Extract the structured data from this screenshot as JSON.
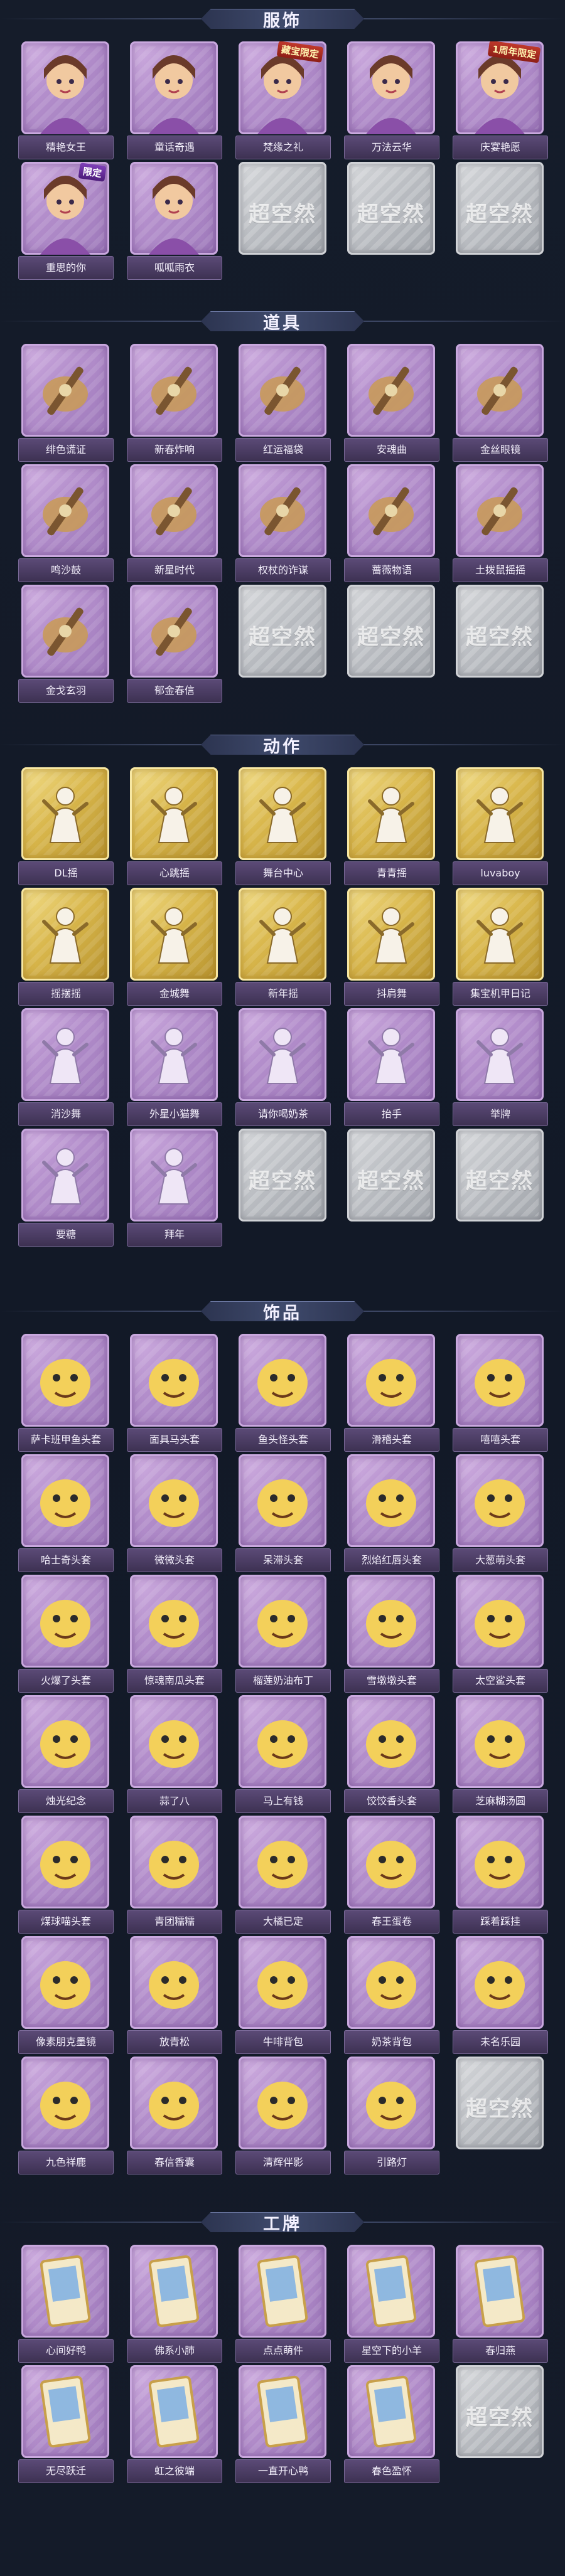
{
  "sections": [
    {
      "title": "服饰",
      "items": [
        {
          "name": "精艳女王",
          "kind": "costume",
          "icon": "queen-costume-icon",
          "tag": ""
        },
        {
          "name": "童话奇遇",
          "kind": "costume",
          "icon": "fairy-girl-costume-icon",
          "tag": ""
        },
        {
          "name": "梵缘之礼",
          "kind": "costume",
          "icon": "white-hair-costume-icon",
          "tag": "藏宝限定"
        },
        {
          "name": "万法云华",
          "kind": "costume",
          "icon": "blue-hair-costume-icon",
          "tag": ""
        },
        {
          "name": "庆宴艳愿",
          "kind": "costume",
          "icon": "party-costume-icon",
          "tag": "1周年限定"
        },
        {
          "name": "重思的你",
          "kind": "costume",
          "icon": "blue-hat-costume-icon",
          "tag": "限定"
        },
        {
          "name": "呱呱雨衣",
          "kind": "costume",
          "icon": "frog-raincoat-costume-icon",
          "tag": ""
        },
        {
          "name": "",
          "kind": "empty",
          "icon": "",
          "tag": ""
        },
        {
          "name": "",
          "kind": "empty",
          "icon": "",
          "tag": ""
        },
        {
          "name": "",
          "kind": "empty",
          "icon": "",
          "tag": ""
        }
      ]
    },
    {
      "title": "道具",
      "items": [
        {
          "name": "绯色谎证",
          "kind": "prop",
          "icon": "sword-icon",
          "tag": ""
        },
        {
          "name": "新春炸响",
          "kind": "prop",
          "icon": "firecracker-icon",
          "tag": ""
        },
        {
          "name": "红运福袋",
          "kind": "prop",
          "icon": "lucky-bag-icon",
          "tag": ""
        },
        {
          "name": "安魂曲",
          "kind": "prop",
          "icon": "red-sword-icon",
          "tag": ""
        },
        {
          "name": "金丝眼镜",
          "kind": "prop",
          "icon": "glasses-icon",
          "tag": ""
        },
        {
          "name": "鸣沙鼓",
          "kind": "prop",
          "icon": "staff-icon",
          "tag": ""
        },
        {
          "name": "新星时代",
          "kind": "prop",
          "icon": "revolver-icon",
          "tag": ""
        },
        {
          "name": "权杖的诈谋",
          "kind": "prop",
          "icon": "scepter-icon",
          "tag": ""
        },
        {
          "name": "蔷薇物语",
          "kind": "prop",
          "icon": "medkit-icon",
          "tag": ""
        },
        {
          "name": "土拨鼠摇摇",
          "kind": "prop",
          "icon": "groundhog-icon",
          "tag": ""
        },
        {
          "name": "金戈玄羽",
          "kind": "prop",
          "icon": "lantern-icon",
          "tag": ""
        },
        {
          "name": "郁金春信",
          "kind": "prop",
          "icon": "fan-icon",
          "tag": ""
        },
        {
          "name": "",
          "kind": "empty",
          "icon": "",
          "tag": ""
        },
        {
          "name": "",
          "kind": "empty",
          "icon": "",
          "tag": ""
        },
        {
          "name": "",
          "kind": "empty",
          "icon": "",
          "tag": ""
        }
      ]
    },
    {
      "title": "动作",
      "items": [
        {
          "name": "DL摇",
          "kind": "action-gold",
          "icon": "dance-pose-icon",
          "tag": ""
        },
        {
          "name": "心跳摇",
          "kind": "action-gold",
          "icon": "dance-pose-icon",
          "tag": ""
        },
        {
          "name": "舞台中心",
          "kind": "action-gold",
          "icon": "dance-pose-icon",
          "tag": ""
        },
        {
          "name": "青青摇",
          "kind": "action-gold",
          "icon": "dance-pose-icon",
          "tag": ""
        },
        {
          "name": "luvaboy",
          "kind": "action-gold",
          "icon": "dance-pose-icon",
          "tag": ""
        },
        {
          "name": "摇摆摇",
          "kind": "action-gold",
          "icon": "dance-pose-icon",
          "tag": ""
        },
        {
          "name": "金城舞",
          "kind": "action-gold",
          "icon": "dance-pose-icon",
          "tag": ""
        },
        {
          "name": "新年摇",
          "kind": "action-gold",
          "icon": "dance-pose-icon",
          "tag": ""
        },
        {
          "name": "抖肩舞",
          "kind": "action-gold",
          "icon": "dance-pose-icon",
          "tag": ""
        },
        {
          "name": "集宝机甲日记",
          "kind": "action-gold",
          "icon": "dance-pose-icon",
          "tag": ""
        },
        {
          "name": "消沙舞",
          "kind": "action",
          "icon": "pose-icon",
          "tag": ""
        },
        {
          "name": "外星小猫舞",
          "kind": "action",
          "icon": "pose-icon",
          "tag": ""
        },
        {
          "name": "请你喝奶茶",
          "kind": "action",
          "icon": "pose-icon",
          "tag": ""
        },
        {
          "name": "抬手",
          "kind": "action",
          "icon": "pose-icon",
          "tag": ""
        },
        {
          "name": "举牌",
          "kind": "action",
          "icon": "pose-icon",
          "tag": ""
        },
        {
          "name": "要糖",
          "kind": "action",
          "icon": "pose-icon",
          "tag": ""
        },
        {
          "name": "拜年",
          "kind": "action",
          "icon": "pose-icon",
          "tag": ""
        },
        {
          "name": "",
          "kind": "empty",
          "icon": "",
          "tag": ""
        },
        {
          "name": "",
          "kind": "empty",
          "icon": "",
          "tag": ""
        },
        {
          "name": "",
          "kind": "empty",
          "icon": "",
          "tag": ""
        }
      ]
    },
    {
      "title": "饰品",
      "items": [
        {
          "name": "萨卡班甲鱼头套",
          "kind": "accessory",
          "icon": "fish-head-icon",
          "tag": ""
        },
        {
          "name": "面具马头套",
          "kind": "accessory",
          "icon": "horse-head-icon",
          "tag": ""
        },
        {
          "name": "鱼头怪头套",
          "kind": "accessory",
          "icon": "fish-monster-head-icon",
          "tag": ""
        },
        {
          "name": "滑稽头套",
          "kind": "accessory",
          "icon": "smirk-emoji-head-icon",
          "tag": ""
        },
        {
          "name": "嘻嘻头套",
          "kind": "accessory",
          "icon": "grin-emoji-head-icon",
          "tag": ""
        },
        {
          "name": "哈士奇头套",
          "kind": "accessory",
          "icon": "husky-head-icon",
          "tag": ""
        },
        {
          "name": "微微头套",
          "kind": "accessory",
          "icon": "sad-emoji-head-icon",
          "tag": ""
        },
        {
          "name": "呆滞头套",
          "kind": "accessory",
          "icon": "stare-emoji-head-icon",
          "tag": ""
        },
        {
          "name": "烈焰红唇头套",
          "kind": "accessory",
          "icon": "sunglasses-head-icon",
          "tag": ""
        },
        {
          "name": "大葱萌头套",
          "kind": "accessory",
          "icon": "scallion-head-icon",
          "tag": ""
        },
        {
          "name": "火爆了头套",
          "kind": "accessory",
          "icon": "fire-head-icon",
          "tag": ""
        },
        {
          "name": "惊魂南瓜头套",
          "kind": "accessory",
          "icon": "pumpkin-head-icon",
          "tag": ""
        },
        {
          "name": "榴莲奶油布丁",
          "kind": "accessory",
          "icon": "pudding-head-icon",
          "tag": ""
        },
        {
          "name": "雪墩墩头套",
          "kind": "accessory",
          "icon": "snowman-head-icon",
          "tag": ""
        },
        {
          "name": "太空鲨头套",
          "kind": "accessory",
          "icon": "space-shark-head-icon",
          "tag": ""
        },
        {
          "name": "烛光纪念",
          "kind": "accessory",
          "icon": "candle-head-icon",
          "tag": ""
        },
        {
          "name": "蒜了八",
          "kind": "accessory",
          "icon": "garlic-head-icon",
          "tag": ""
        },
        {
          "name": "马上有钱",
          "kind": "accessory",
          "icon": "lucky-cat-head-icon",
          "tag": ""
        },
        {
          "name": "饺饺香头套",
          "kind": "accessory",
          "icon": "dumpling-head-icon",
          "tag": ""
        },
        {
          "name": "芝麻糊汤圆",
          "kind": "accessory",
          "icon": "tangyuan-head-icon",
          "tag": ""
        },
        {
          "name": "煤球喵头套",
          "kind": "accessory",
          "icon": "black-cat-head-icon",
          "tag": ""
        },
        {
          "name": "青团糯糯",
          "kind": "accessory",
          "icon": "green-dumpling-head-icon",
          "tag": ""
        },
        {
          "name": "大橘已定",
          "kind": "accessory",
          "icon": "orange-head-icon",
          "tag": ""
        },
        {
          "name": "春王蛋卷",
          "kind": "accessory",
          "icon": "egg-roll-head-icon",
          "tag": ""
        },
        {
          "name": "踩着踩挂",
          "kind": "accessory",
          "icon": "white-fluff-head-icon",
          "tag": ""
        },
        {
          "name": "像素朋克墨镜",
          "kind": "accessory",
          "icon": "pixel-sunglasses-icon",
          "tag": ""
        },
        {
          "name": "放青松",
          "kind": "accessory",
          "icon": "bonsai-icon",
          "tag": ""
        },
        {
          "name": "牛啡背包",
          "kind": "accessory",
          "icon": "cow-backpack-icon",
          "tag": ""
        },
        {
          "name": "奶茶背包",
          "kind": "accessory",
          "icon": "milk-tea-backpack-icon",
          "tag": ""
        },
        {
          "name": "未名乐园",
          "kind": "accessory",
          "icon": "doll-icon",
          "tag": ""
        },
        {
          "name": "九色祥鹿",
          "kind": "accessory",
          "icon": "deer-icon",
          "tag": ""
        },
        {
          "name": "春信香囊",
          "kind": "accessory",
          "icon": "sachet-icon",
          "tag": ""
        },
        {
          "name": "清辉伴影",
          "kind": "accessory",
          "icon": "rabbit-doll-icon",
          "tag": ""
        },
        {
          "name": "引路灯",
          "kind": "accessory",
          "icon": "lantern-pendant-icon",
          "tag": ""
        },
        {
          "name": "",
          "kind": "empty",
          "icon": "",
          "tag": ""
        }
      ]
    },
    {
      "title": "工牌",
      "items": [
        {
          "name": "心间好鸭",
          "kind": "card",
          "icon": "badge-gold-icon",
          "tag": ""
        },
        {
          "name": "佛系小肺",
          "kind": "card",
          "icon": "badge-sepia-icon",
          "tag": ""
        },
        {
          "name": "点点萌件",
          "kind": "card",
          "icon": "badge-green-icon",
          "tag": ""
        },
        {
          "name": "星空下的小羊",
          "kind": "card",
          "icon": "badge-blue-icon",
          "tag": ""
        },
        {
          "name": "春归燕",
          "kind": "card",
          "icon": "badge-pink-icon",
          "tag": ""
        },
        {
          "name": "无尽跃迁",
          "kind": "card",
          "icon": "badge-galaxy-icon",
          "tag": ""
        },
        {
          "name": "虹之彼端",
          "kind": "card",
          "icon": "badge-rainbow-icon",
          "tag": ""
        },
        {
          "name": "一直开心鸭",
          "kind": "card",
          "icon": "badge-sky-icon",
          "tag": ""
        },
        {
          "name": "春色盈怀",
          "kind": "card",
          "icon": "badge-silhouette-icon",
          "tag": ""
        },
        {
          "name": "",
          "kind": "empty",
          "icon": "",
          "tag": ""
        }
      ]
    }
  ],
  "watermark": "超空然",
  "colors": {
    "background": "#131a26",
    "purple_card": "#b48fcc",
    "gold_card": "#d9b74c",
    "empty_card": "#b8bbc0",
    "label_bg": "#4a3c63"
  }
}
